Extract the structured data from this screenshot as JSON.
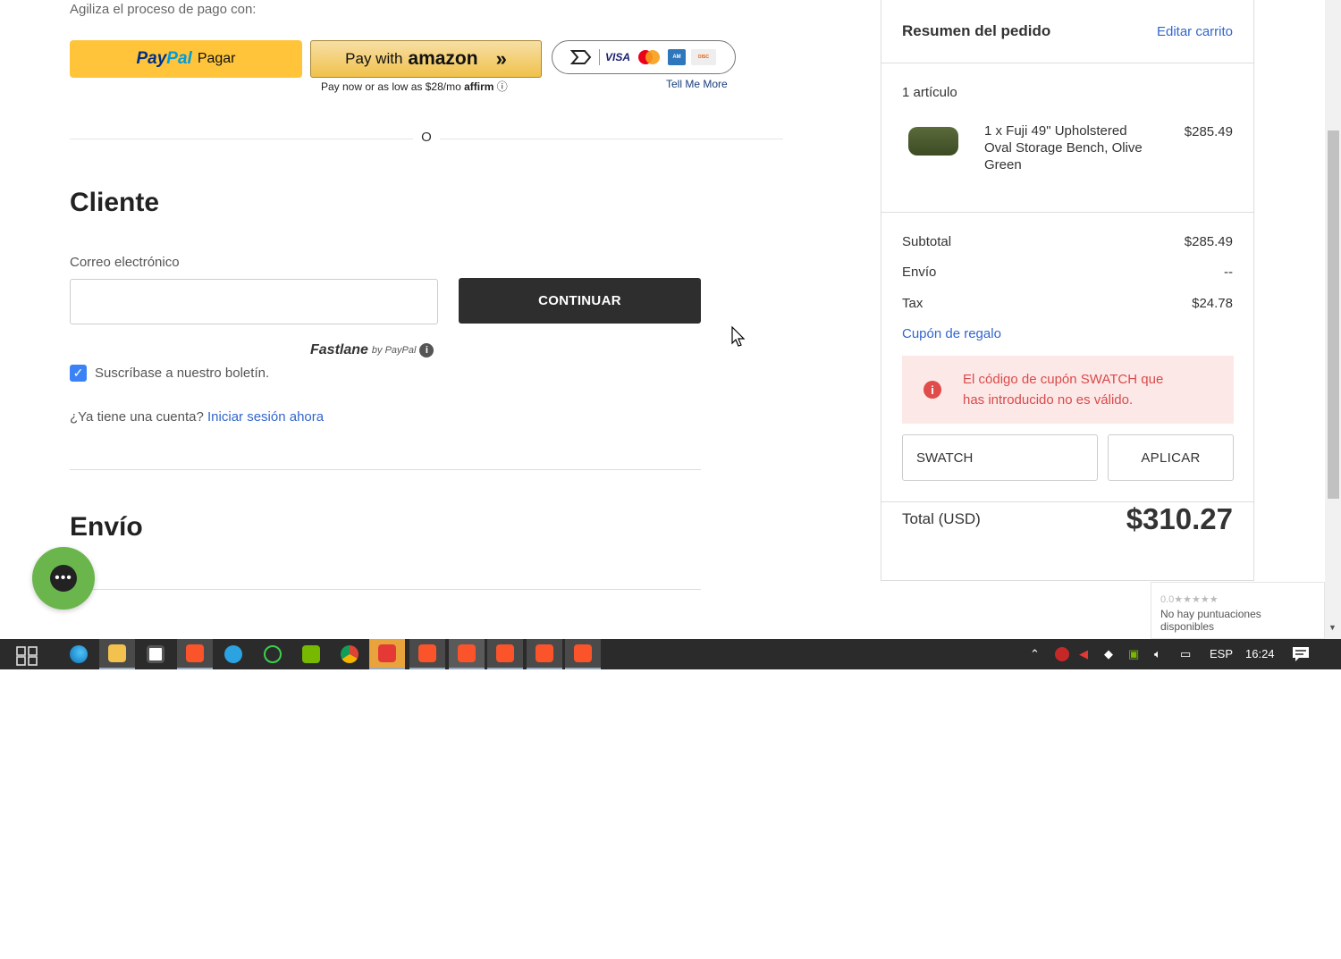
{
  "express": {
    "label": "Agiliza el proceso de pago con:",
    "paypal_logo_1": "Pay",
    "paypal_logo_2": "Pal",
    "paypal_text": "Pagar",
    "amazon_prefix": "Pay with",
    "amazon_word": "amazon",
    "affirm_text": "Pay now or as low as $28/mo",
    "affirm_logo": "affirm",
    "tell_more": "Tell Me More",
    "cards": [
      "VISA",
      "MC",
      "AMEX",
      "DISCOVER"
    ],
    "or_text": "O"
  },
  "customer": {
    "title": "Cliente",
    "email_label": "Correo electrónico",
    "email_value": "",
    "continue_label": "CONTINUAR",
    "fastlane_word": "Fastlane",
    "fastlane_by": "by PayPal",
    "newsletter_label": "Suscríbase a nuestro boletín.",
    "newsletter_checked": true,
    "have_account": "¿Ya tiene una cuenta?",
    "signin_link": "Iniciar sesión ahora"
  },
  "shipping": {
    "title": "Envío"
  },
  "summary": {
    "title": "Resumen del pedido",
    "edit_cart": "Editar carrito",
    "items_count": "1 artículo",
    "product_name": "1 x Fuji 49\" Upholstered Oval Storage Bench, Olive Green",
    "product_price": "$285.49",
    "subtotal_label": "Subtotal",
    "subtotal_value": "$285.49",
    "shipping_label": "Envío",
    "shipping_value": "--",
    "tax_label": "Tax",
    "tax_value": "$24.78",
    "coupon_link": "Cupón de regalo",
    "error_text": "El código de cupón SWATCH que has introducido no es válido.",
    "coupon_value": "SWATCH",
    "apply_label": "APLICAR",
    "total_label": "Total (USD)",
    "total_value": "$310.27"
  },
  "rating": {
    "stars_text": "0.0★★★★★",
    "text": "No hay puntuaciones disponibles"
  },
  "taskbar": {
    "language": "ESP",
    "time": "16:24"
  },
  "colors": {
    "paypal_yellow": "#ffc439",
    "link_blue": "#3366cc",
    "error_red": "#d94a4a",
    "error_bg": "#fde8e8",
    "dark_button": "#2e2e2e",
    "chat_green": "#6bb54d"
  }
}
